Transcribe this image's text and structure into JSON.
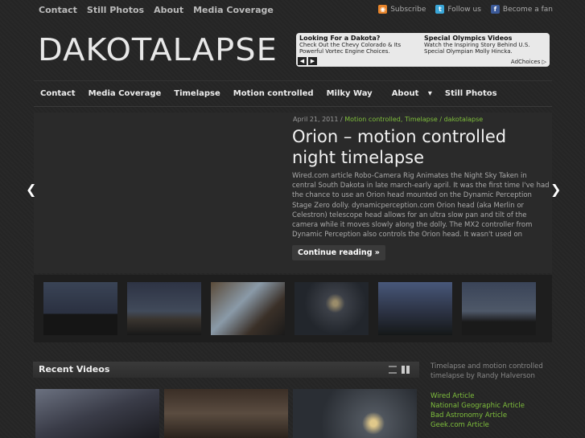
{
  "top_nav": [
    "Contact",
    "Still Photos",
    "About",
    "Media Coverage"
  ],
  "social": {
    "subscribe": "Subscribe",
    "follow": "Follow us",
    "fan": "Become a fan"
  },
  "logo": "DAKOTALAPSE",
  "ad": {
    "left_title": "Looking For a Dakota?",
    "left_text": "Check Out the Chevy Colorado & Its Powerful Vortec Engine Choices.",
    "right_title": "Special Olympics Videos",
    "right_text": "Watch the Inspiring Story Behind U.S. Special Olympian Molly Hincka.",
    "choices": "AdChoices"
  },
  "main_nav": [
    "Contact",
    "Media Coverage",
    "Timelapse",
    "Motion controlled",
    "Milky Way",
    "About",
    "Still Photos"
  ],
  "post": {
    "date": "April 21, 2011 /",
    "cats": "Motion controlled, Timelapse / dakotalapse",
    "title": "Orion – motion controlled night timelapse",
    "excerpt": "Wired.com article Robo-Camera Rig Animates the Night Sky Taken in central South Dakota in late march-early april. It was the first time I've had the chance to use an Orion head mounted on the Dynamic Perception Stage Zero dolly. dynamicperception.com Orion head (aka Merlin or Celestron) telescope head allows for an ultra slow pan and tilt of the camera while it moves slowly along the dolly. The MX2 controller from Dynamic Perception also controls the Orion head.  It wasn't used on",
    "more": "Continue reading »"
  },
  "recent_videos": "Recent Videos",
  "sidebar": {
    "desc": "Timelapse and motion controlled timelapse by Randy Halverson",
    "links": [
      "Wired Article",
      "National Geographic Article",
      "Bad Astronomy Article",
      "Geek.com Article"
    ]
  }
}
